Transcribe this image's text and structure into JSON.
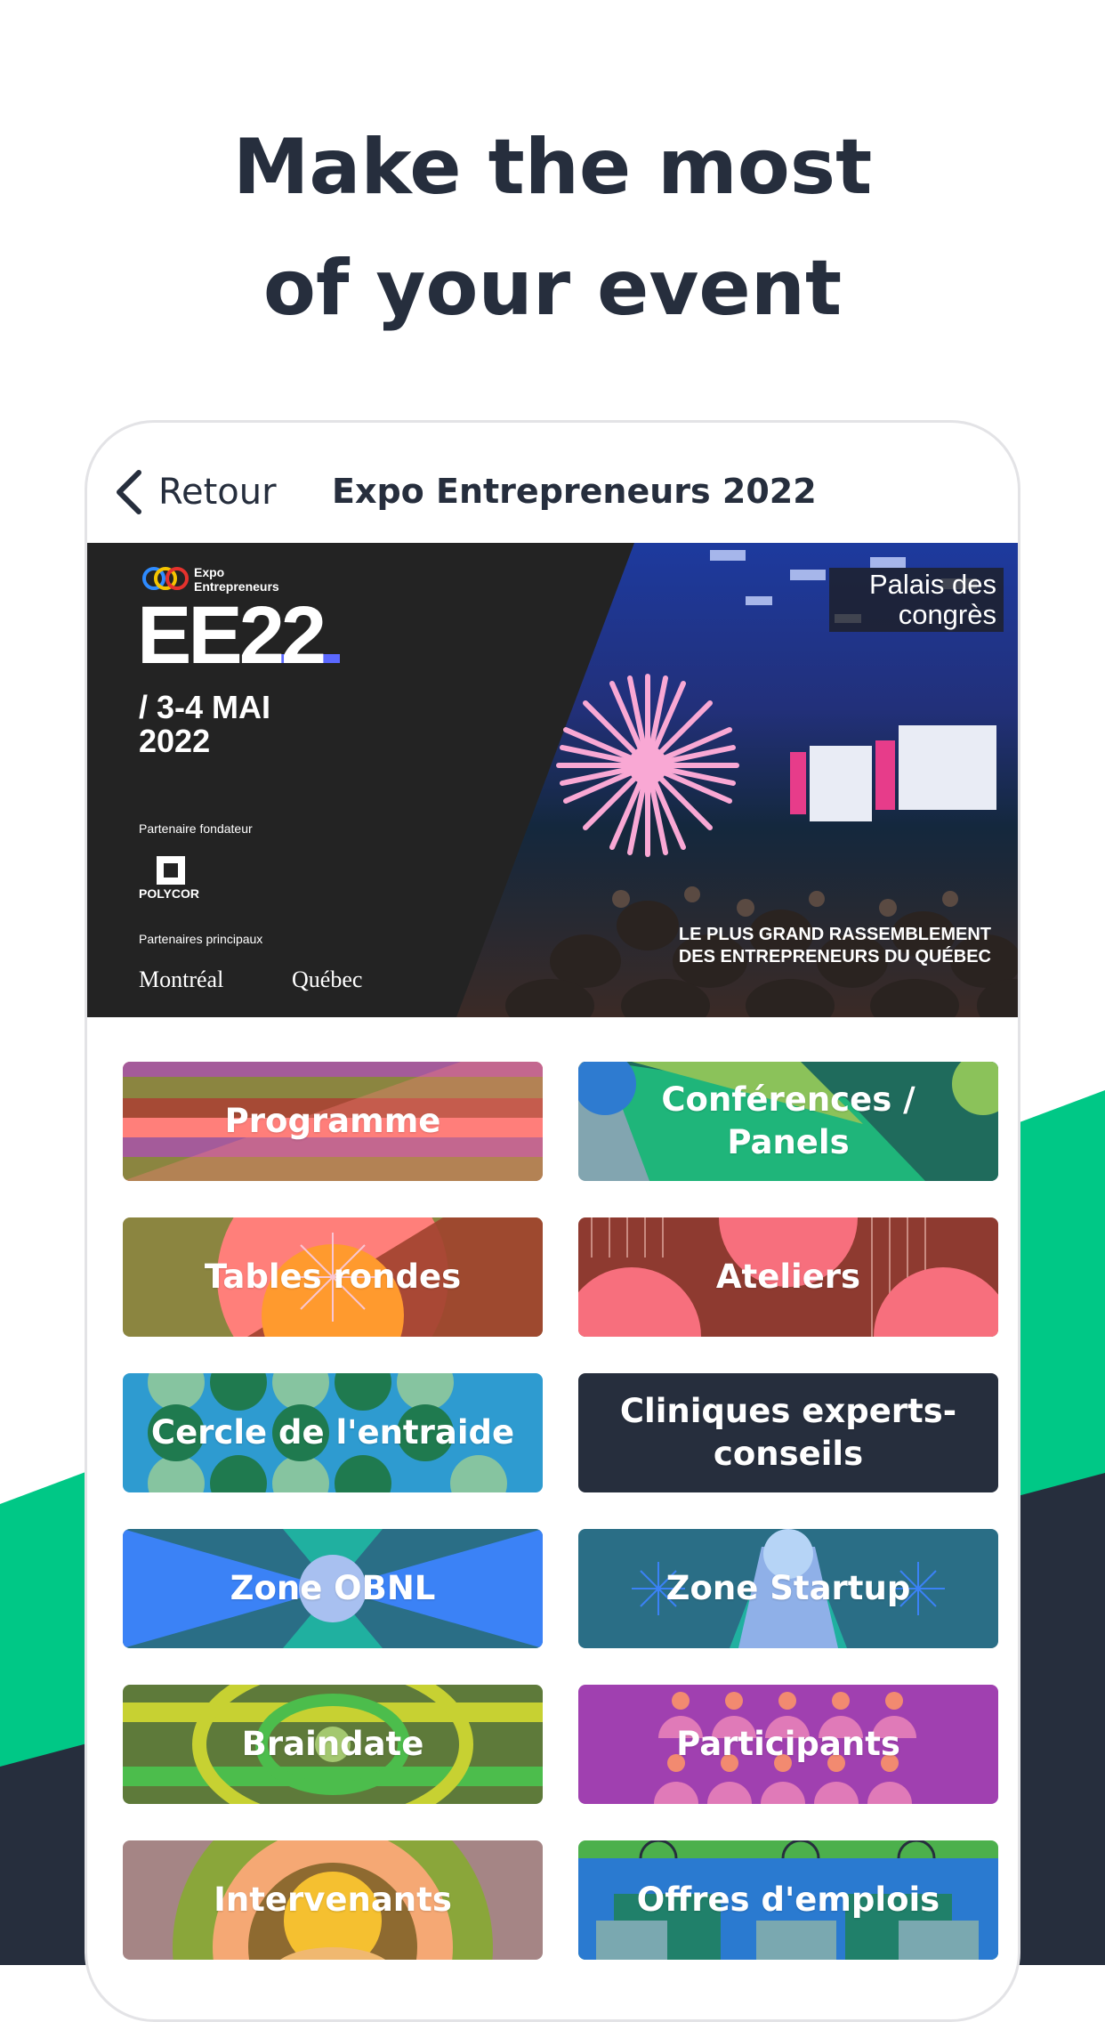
{
  "headline": {
    "line1": "Make the most",
    "line2": "of your event"
  },
  "colors": {
    "dark": "#262e3d",
    "green": "#00c886",
    "accent_pink": "#f9a8d4"
  },
  "navbar": {
    "back_label": "Retour",
    "title": "Expo Entrepreneurs 2022",
    "back_icon": "chevron-left-icon"
  },
  "banner": {
    "brand_small": "Expo Entrepreneurs",
    "brand_big": "EE22",
    "date": "/ 3-4 MAI 2022",
    "partner_founder_label": "Partenaire fondateur",
    "partner_founder": "POLYCOR",
    "partners_label": "Partenaires principaux",
    "partner_1": "Montréal",
    "partner_2": "Québec",
    "venue": "Palais des congrès",
    "tagline": "LE PLUS GRAND RASSEMBLEMENT DES ENTREPRENEURS DU QUÉBEC"
  },
  "tiles": [
    {
      "label": "Programme"
    },
    {
      "label": "Conférences / Panels"
    },
    {
      "label": "Tables rondes"
    },
    {
      "label": "Ateliers"
    },
    {
      "label": "Cercle de l'entraide"
    },
    {
      "label": "Cliniques experts-conseils"
    },
    {
      "label": "Zone OBNL"
    },
    {
      "label": "Zone Startup"
    },
    {
      "label": "Braindate"
    },
    {
      "label": "Participants"
    },
    {
      "label": "Intervenants"
    },
    {
      "label": "Offres d'emplois"
    }
  ]
}
